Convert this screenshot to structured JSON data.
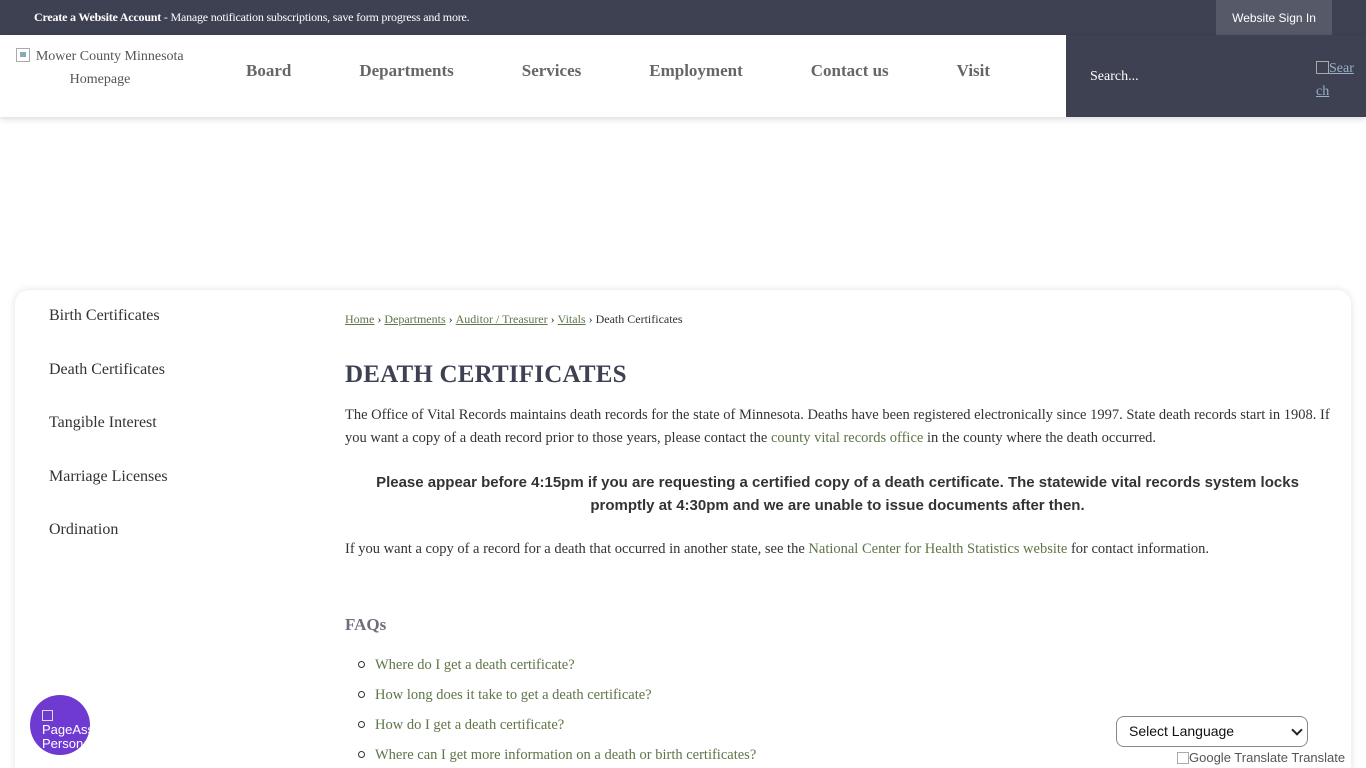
{
  "topbar": {
    "create_account_bold": "Create a Website Account",
    "create_account_rest": " - Manage notification subscriptions, save form progress and more.",
    "signin_label": "Website Sign In"
  },
  "header": {
    "logo_alt": "Mower County Minnesota Homepage",
    "nav": [
      "Board",
      "Departments",
      "Services",
      "Employment",
      "Contact us",
      "Visit"
    ],
    "search_placeholder": "Search...",
    "search_button_alt": "Search"
  },
  "sidebar": {
    "items": [
      "Birth Certificates",
      "Death Certificates",
      "Tangible Interest",
      "Marriage Licenses",
      "Ordination"
    ]
  },
  "breadcrumb": {
    "links": [
      "Home",
      "Departments",
      "Auditor / Treasurer",
      "Vitals"
    ],
    "current": "Death Certificates",
    "separator": "›"
  },
  "main": {
    "title": "DEATH CERTIFICATES",
    "para1_a": "The Office of Vital Records maintains death records for the state of Minnesota. Deaths have been registered electronically since 1997. State death records start in 1908. If you want a copy of a death record prior to those years, please contact the ",
    "para1_link": "county vital records office",
    "para1_b": " in the county where the death occurred.",
    "notice": "Please appear before 4:15pm if you are requesting a certified copy of a death certificate. The statewide vital records system locks promptly at 4:30pm and we are unable to issue documents after then.",
    "para2_a": "If you want a copy of a record for a death that occurred in another state, see the ",
    "para2_link": "National Center for Health Statistics website",
    "para2_b": " for contact information.",
    "faqs_heading": "FAQs",
    "faqs": [
      "Where do I get a death certificate?",
      "How long does it take to get a death certificate?",
      "How do I get a death certificate?",
      "Where can I get more information on a death or birth certificates?"
    ]
  },
  "widgets": {
    "page_button_alt": "PageAssist Personalization",
    "language_select": "Select Language",
    "google_translate_alt": "Google Translate",
    "google_translate_label": "Translate"
  }
}
